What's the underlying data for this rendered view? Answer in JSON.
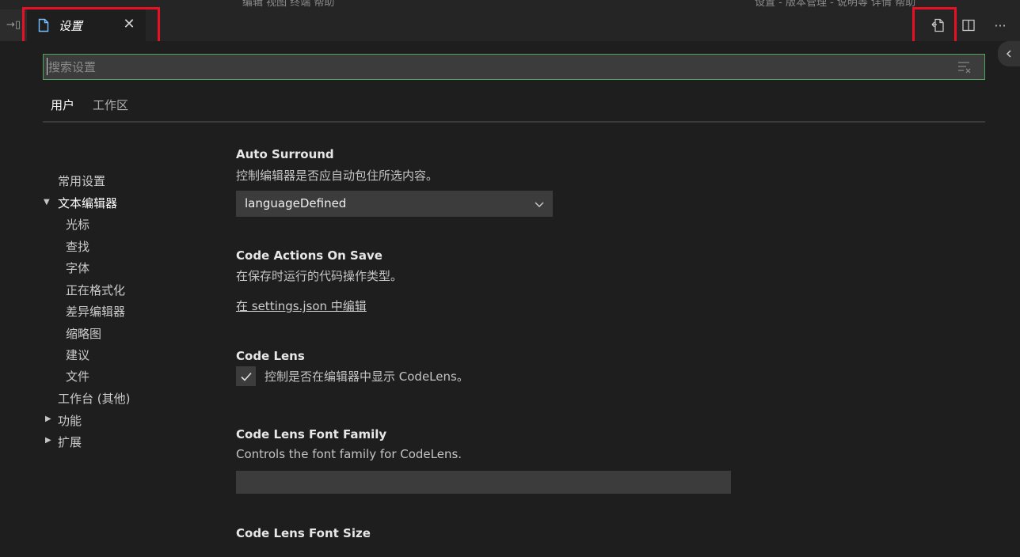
{
  "top_strip": {
    "left_text": "编辑  视图  终端  帮助",
    "right_text": "设置 - 版本管理 - 说明等  详情  帮助"
  },
  "tab": {
    "title": "设置",
    "close_symbol": "✕"
  },
  "gutter": {
    "icon_text": "→▯"
  },
  "actions": {
    "open_json_icon": "open-settings-json-icon",
    "split_icon": "split-editor-icon",
    "more_symbol": "···"
  },
  "search": {
    "placeholder": "搜索设置",
    "value": ""
  },
  "scopes": [
    {
      "label": "用户",
      "active": true
    },
    {
      "label": "工作区",
      "active": false
    }
  ],
  "toc": {
    "items": [
      {
        "label": "常用设置",
        "level": 0,
        "arrow": ""
      },
      {
        "label": "文本编辑器",
        "level": 0,
        "arrow": "▼"
      },
      {
        "label": "光标",
        "level": 1,
        "arrow": ""
      },
      {
        "label": "查找",
        "level": 1,
        "arrow": ""
      },
      {
        "label": "字体",
        "level": 1,
        "arrow": ""
      },
      {
        "label": "正在格式化",
        "level": 1,
        "arrow": ""
      },
      {
        "label": "差异编辑器",
        "level": 1,
        "arrow": ""
      },
      {
        "label": "缩略图",
        "level": 1,
        "arrow": ""
      },
      {
        "label": "建议",
        "level": 1,
        "arrow": ""
      },
      {
        "label": "文件",
        "level": 1,
        "arrow": ""
      },
      {
        "label": "工作台 (其他)",
        "level": 0,
        "arrow": ""
      },
      {
        "label": "功能",
        "level": 0,
        "arrow": "▶"
      },
      {
        "label": "扩展",
        "level": 0,
        "arrow": "▶"
      }
    ]
  },
  "settings": {
    "auto_surround": {
      "title": "Auto Surround",
      "description": "控制编辑器是否应自动包住所选内容。",
      "value": "languageDefined"
    },
    "code_actions_on_save": {
      "title": "Code Actions On Save",
      "description": "在保存时运行的代码操作类型。",
      "link": "在 settings.json 中编辑"
    },
    "code_lens": {
      "title": "Code Lens",
      "checkbox_label": "控制是否在编辑器中显示 CodeLens。",
      "checked": true
    },
    "code_lens_font_family": {
      "title": "Code Lens Font Family",
      "description": "Controls the font family for CodeLens.",
      "value": ""
    },
    "code_lens_font_size": {
      "title": "Code Lens Font Size"
    }
  },
  "colors": {
    "highlight_box": "#e81123",
    "search_border": "#4ea65d",
    "background": "#1e1e1e"
  }
}
